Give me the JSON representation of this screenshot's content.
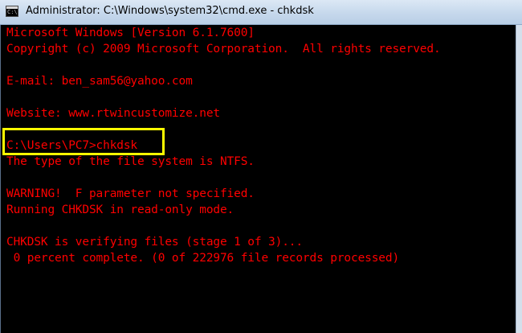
{
  "window": {
    "title": "Administrator: C:\\Windows\\system32\\cmd.exe - chkdsk",
    "icon": "cmd-icon",
    "icon_glyph": "C:\\"
  },
  "console": {
    "text_color": "#ff0000",
    "background": "#000000",
    "lines": [
      "Microsoft Windows [Version 6.1.7600]",
      "Copyright (c) 2009 Microsoft Corporation.  All rights reserved.",
      "E-mail: ben_sam56@yahoo.com",
      "Website: www.rtwincustomize.net",
      "C:\\Users\\PC7>chkdsk",
      "The type of the file system is NTFS.",
      "WARNING!  F parameter not specified.",
      "Running CHKDSK in read-only mode.",
      "CHKDSK is verifying files (stage 1 of 3)...",
      " 0 percent complete. (0 of 222976 file records processed)"
    ]
  },
  "highlight_color": "#ffff00"
}
